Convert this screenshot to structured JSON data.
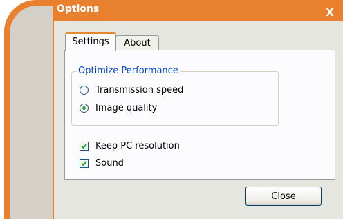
{
  "window": {
    "title": "Options",
    "close_glyph": "X"
  },
  "tabs": [
    {
      "label": "Settings",
      "active": true
    },
    {
      "label": "About",
      "active": false
    }
  ],
  "optimize": {
    "legend": "Optimize Performance",
    "options": [
      {
        "label": "Transmission speed",
        "selected": false
      },
      {
        "label": "Image quality",
        "selected": true
      }
    ]
  },
  "checkboxes": [
    {
      "label": "Keep PC resolution",
      "checked": true
    },
    {
      "label": "Sound",
      "checked": true
    }
  ],
  "buttons": {
    "close_label": "Close"
  },
  "colors": {
    "accent": "#E8802E",
    "legend": "#0046D5",
    "radio_dot": "#2FA13A"
  }
}
